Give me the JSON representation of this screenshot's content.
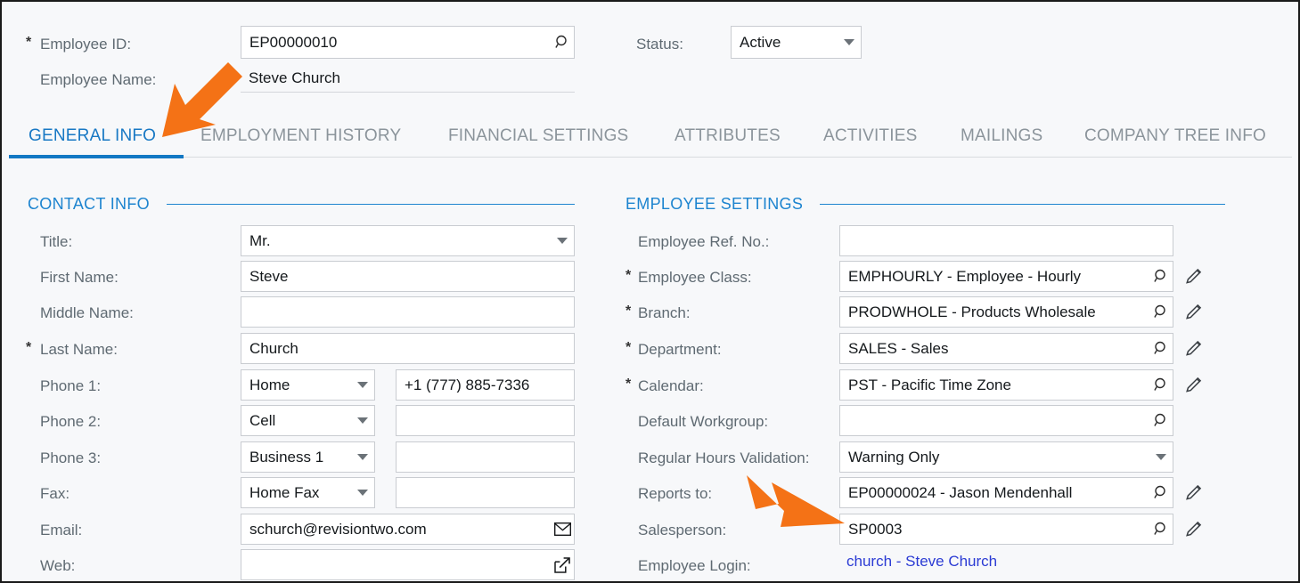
{
  "header": {
    "employee_id_label": "Employee ID:",
    "employee_id_value": "EP00000010",
    "employee_name_label": "Employee Name:",
    "employee_name_value": "Steve Church",
    "status_label": "Status:",
    "status_value": "Active",
    "required_mark": "*"
  },
  "tabs": [
    {
      "label": "GENERAL INFO",
      "active": true
    },
    {
      "label": "EMPLOYMENT HISTORY",
      "active": false
    },
    {
      "label": "FINANCIAL SETTINGS",
      "active": false
    },
    {
      "label": "ATTRIBUTES",
      "active": false
    },
    {
      "label": "ACTIVITIES",
      "active": false
    },
    {
      "label": "MAILINGS",
      "active": false
    },
    {
      "label": "COMPANY TREE INFO",
      "active": false
    }
  ],
  "contact_info": {
    "section_title": "CONTACT INFO",
    "fields": {
      "title_label": "Title:",
      "title_value": "Mr.",
      "first_name_label": "First Name:",
      "first_name_value": "Steve",
      "middle_name_label": "Middle Name:",
      "middle_name_value": "",
      "last_name_label": "Last Name:",
      "last_name_value": "Church",
      "phone1_label": "Phone 1:",
      "phone1_type": "Home",
      "phone1_value": "+1 (777) 885-7336",
      "phone2_label": "Phone 2:",
      "phone2_type": "Cell",
      "phone2_value": "",
      "phone3_label": "Phone 3:",
      "phone3_type": "Business 1",
      "phone3_value": "",
      "fax_label": "Fax:",
      "fax_type": "Home Fax",
      "fax_value": "",
      "email_label": "Email:",
      "email_value": "schurch@revisiontwo.com",
      "web_label": "Web:",
      "web_value": ""
    }
  },
  "employee_settings": {
    "section_title": "EMPLOYEE SETTINGS",
    "fields": {
      "ref_no_label": "Employee Ref. No.:",
      "ref_no_value": "",
      "employee_class_label": "Employee Class:",
      "employee_class_value": "EMPHOURLY - Employee - Hourly",
      "branch_label": "Branch:",
      "branch_value": "PRODWHOLE - Products Wholesale",
      "department_label": "Department:",
      "department_value": "SALES - Sales",
      "calendar_label": "Calendar:",
      "calendar_value": "PST - Pacific Time Zone",
      "default_workgroup_label": "Default Workgroup:",
      "default_workgroup_value": "",
      "regular_hours_validation_label": "Regular Hours Validation:",
      "regular_hours_validation_value": "Warning Only",
      "reports_to_label": "Reports to:",
      "reports_to_value": "EP00000024 - Jason Mendenhall",
      "salesperson_label": "Salesperson:",
      "salesperson_value": "SP0003",
      "employee_login_label": "Employee Login:",
      "employee_login_value": "church - Steve Church"
    }
  },
  "icons": {
    "search": "magnifier-icon",
    "edit": "pencil-icon",
    "email": "envelope-icon",
    "web": "external-link-icon",
    "dropdown": "chevron-down-icon"
  },
  "annotations": {
    "arrow_color": "#f47216",
    "arrow_1_target": "GENERAL INFO",
    "arrow_2_target": "Salesperson"
  },
  "colors": {
    "accent": "#1d84cf",
    "tab_active": "#1878c4",
    "label": "#5f6a72",
    "link": "#2b3bd4",
    "background": "#f7f8fa"
  }
}
